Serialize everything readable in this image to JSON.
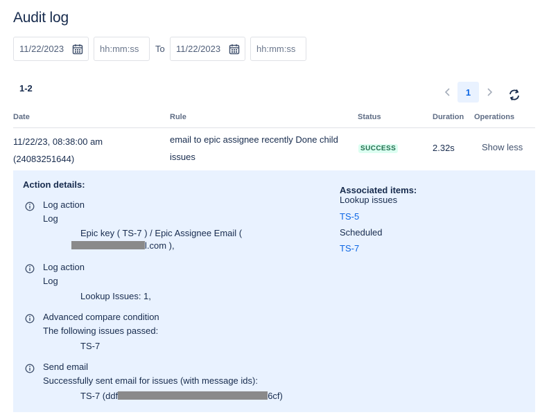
{
  "page": {
    "title": "Audit log"
  },
  "filters": {
    "from_date": "11/22/2023",
    "from_time_placeholder": "hh:mm:ss",
    "to_label": "To",
    "to_date": "11/22/2023",
    "to_time_placeholder": "hh:mm:ss"
  },
  "results": {
    "range": "1-2"
  },
  "pagination": {
    "current_page": "1"
  },
  "table": {
    "headers": {
      "date": "Date",
      "rule": "Rule",
      "status": "Status",
      "duration": "Duration",
      "operations": "Operations"
    },
    "row": {
      "date": "11/22/23, 08:38:00 am",
      "id": "(24083251644)",
      "rule": "email to epic assignee recently Done child issues",
      "status": "SUCCESS",
      "duration": "2.32s",
      "operation": "Show less"
    }
  },
  "details": {
    "heading": "Action details:",
    "actions": [
      {
        "title": "Log action",
        "subtitle": "Log",
        "body_1": "Epic key ( TS-7 ) / Epic Assignee Email (",
        "body_2": "l.com ),",
        "icon": "info-icon"
      },
      {
        "title": "Log action",
        "subtitle": "Log",
        "body_1": "Lookup Issues: 1,",
        "icon": "info-icon"
      },
      {
        "title": "Advanced compare condition",
        "subtitle": "The following issues passed:",
        "body_1": "TS-7",
        "icon": "info-icon"
      },
      {
        "title": "Send email",
        "subtitle": "Successfully sent email for issues (with message ids):",
        "body_1": "TS-7 (ddf",
        "body_2": "6cf)",
        "icon": "info-icon"
      }
    ],
    "associated": {
      "heading": "Associated items:",
      "lookup_label": "Lookup issues",
      "lookup_link": "TS-5",
      "scheduled_label": "Scheduled",
      "scheduled_link": "TS-7"
    }
  },
  "colors": {
    "accent": "#0c66e4",
    "details_bg": "#e9f2ff",
    "success_bg": "#dcfff1",
    "success_text": "#216e4e"
  }
}
